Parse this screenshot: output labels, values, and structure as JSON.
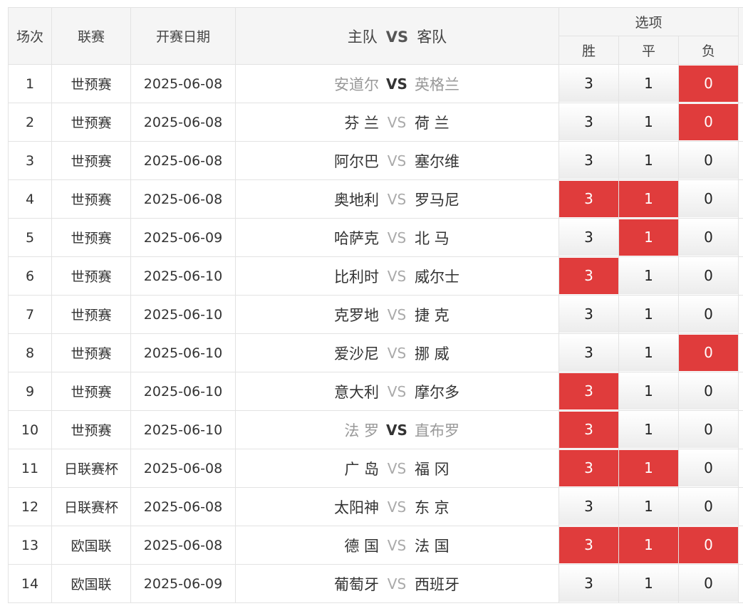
{
  "header": {
    "col_no": "场次",
    "col_league": "联赛",
    "col_date": "开赛日期",
    "col_home": "主队",
    "col_vs": "VS",
    "col_away": "客队",
    "options": "选项",
    "opt_win": "胜",
    "opt_draw": "平",
    "opt_loss": "负"
  },
  "vs_label": "VS",
  "colors": {
    "selected": "#e03c3c",
    "header_bg": "#f5f5f5",
    "border": "#e3e3e3"
  },
  "matches": [
    {
      "no": "1",
      "league": "世预赛",
      "date": "2025-06-08",
      "home": "安道尔",
      "away": "英格兰",
      "win": "3",
      "draw": "1",
      "loss": "0",
      "sel": [
        "loss"
      ],
      "muted": true
    },
    {
      "no": "2",
      "league": "世预赛",
      "date": "2025-06-08",
      "home": "芬 兰",
      "away": "荷 兰",
      "win": "3",
      "draw": "1",
      "loss": "0",
      "sel": [
        "loss"
      ],
      "muted": false
    },
    {
      "no": "3",
      "league": "世预赛",
      "date": "2025-06-08",
      "home": "阿尔巴",
      "away": "塞尔维",
      "win": "3",
      "draw": "1",
      "loss": "0",
      "sel": [],
      "muted": false
    },
    {
      "no": "4",
      "league": "世预赛",
      "date": "2025-06-08",
      "home": "奥地利",
      "away": "罗马尼",
      "win": "3",
      "draw": "1",
      "loss": "0",
      "sel": [
        "win",
        "draw"
      ],
      "muted": false
    },
    {
      "no": "5",
      "league": "世预赛",
      "date": "2025-06-09",
      "home": "哈萨克",
      "away": "北 马",
      "win": "3",
      "draw": "1",
      "loss": "0",
      "sel": [
        "draw"
      ],
      "muted": false
    },
    {
      "no": "6",
      "league": "世预赛",
      "date": "2025-06-10",
      "home": "比利时",
      "away": "威尔士",
      "win": "3",
      "draw": "1",
      "loss": "0",
      "sel": [
        "win"
      ],
      "muted": false
    },
    {
      "no": "7",
      "league": "世预赛",
      "date": "2025-06-10",
      "home": "克罗地",
      "away": "捷 克",
      "win": "3",
      "draw": "1",
      "loss": "0",
      "sel": [],
      "muted": false
    },
    {
      "no": "8",
      "league": "世预赛",
      "date": "2025-06-10",
      "home": "爱沙尼",
      "away": "挪 威",
      "win": "3",
      "draw": "1",
      "loss": "0",
      "sel": [
        "loss"
      ],
      "muted": false
    },
    {
      "no": "9",
      "league": "世预赛",
      "date": "2025-06-10",
      "home": "意大利",
      "away": "摩尔多",
      "win": "3",
      "draw": "1",
      "loss": "0",
      "sel": [
        "win"
      ],
      "muted": false
    },
    {
      "no": "10",
      "league": "世预赛",
      "date": "2025-06-10",
      "home": "法 罗",
      "away": "直布罗",
      "win": "3",
      "draw": "1",
      "loss": "0",
      "sel": [
        "win"
      ],
      "muted": true
    },
    {
      "no": "11",
      "league": "日联赛杯",
      "date": "2025-06-08",
      "home": "广 岛",
      "away": "福 冈",
      "win": "3",
      "draw": "1",
      "loss": "0",
      "sel": [
        "win",
        "draw"
      ],
      "muted": false
    },
    {
      "no": "12",
      "league": "日联赛杯",
      "date": "2025-06-08",
      "home": "太阳神",
      "away": "东 京",
      "win": "3",
      "draw": "1",
      "loss": "0",
      "sel": [],
      "muted": false
    },
    {
      "no": "13",
      "league": "欧国联",
      "date": "2025-06-08",
      "home": "德 国",
      "away": "法 国",
      "win": "3",
      "draw": "1",
      "loss": "0",
      "sel": [
        "win",
        "draw",
        "loss"
      ],
      "muted": false
    },
    {
      "no": "14",
      "league": "欧国联",
      "date": "2025-06-09",
      "home": "葡萄牙",
      "away": "西班牙",
      "win": "3",
      "draw": "1",
      "loss": "0",
      "sel": [],
      "muted": false
    }
  ]
}
